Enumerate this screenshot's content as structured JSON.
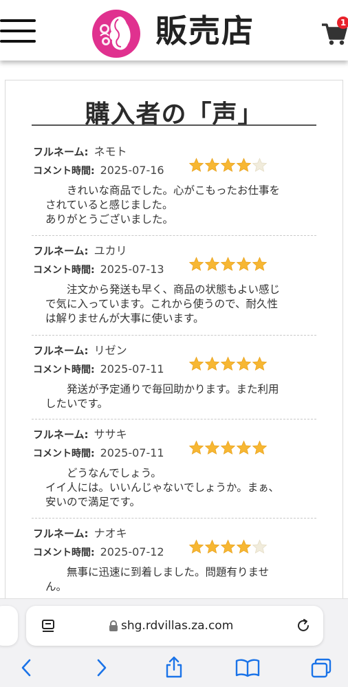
{
  "header": {
    "brand": "販売店",
    "cart_count": "1",
    "menu_icon": "hamburger-menu-icon",
    "cart_icon": "cart-icon",
    "logo_color": "#e0318f"
  },
  "reviews": {
    "title": "購入者の「声」",
    "name_label": "フルネーム:",
    "time_label": "コメント時間:",
    "star_color": "#f7b733",
    "star_empty_color": "#f1ecdc",
    "items": [
      {
        "name": "ネモト",
        "date": "2025-07-16",
        "rating": 4,
        "lines": [
          "　　きれいな商品でした。心がこもったお仕事を",
          "されていると感じました。",
          "ありがとうございました。"
        ]
      },
      {
        "name": "ユカリ",
        "date": "2025-07-13",
        "rating": 5,
        "lines": [
          "　　注文から発送も早く、商品の状態もよい感じ",
          "で気に入っています。これから使うので、耐久性",
          "は解りませんが大事に使います。"
        ]
      },
      {
        "name": "リゼン",
        "date": "2025-07-11",
        "rating": 5,
        "lines": [
          "　　発送が予定通りで毎回助かります。また利用",
          "したいです。"
        ]
      },
      {
        "name": "ササキ",
        "date": "2025-07-11",
        "rating": 5,
        "lines": [
          "　　どうなんでしょう。",
          "イイ人には。いいんじゃないでしょうか。まぁ、",
          "安いので満足です。"
        ]
      },
      {
        "name": "ナオキ",
        "date": "2025-07-12",
        "rating": 4,
        "lines": [
          "　　無事に迅速に到着しました。問題有りませ",
          "ん。"
        ]
      }
    ]
  },
  "browser": {
    "url": "shg.rdvillas.za.com",
    "accent": "#1a73e8"
  }
}
